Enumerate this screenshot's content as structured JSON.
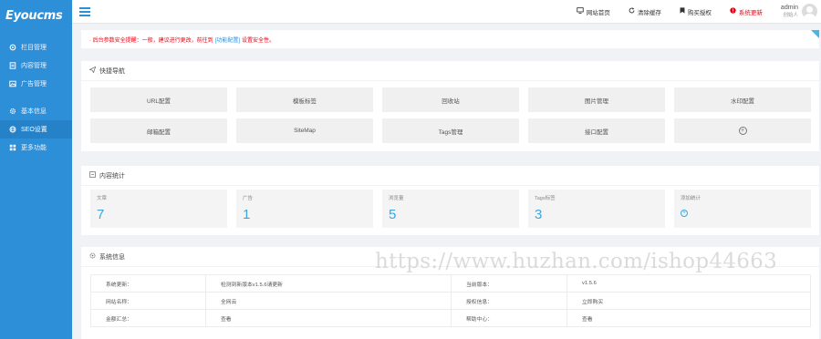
{
  "logo": {
    "text": "Eyoucms"
  },
  "sidebar": {
    "items": [
      {
        "label": "栏目管理",
        "icon": "settings-icon"
      },
      {
        "label": "内容管理",
        "icon": "document-icon"
      },
      {
        "label": "广告管理",
        "icon": "image-icon"
      },
      {
        "label": "基本信息",
        "icon": "gear-icon"
      },
      {
        "label": "SEO设置",
        "icon": "globe-icon"
      },
      {
        "label": "更多功能",
        "icon": "grid-icon"
      }
    ],
    "active_index": 4
  },
  "topbar": {
    "links": [
      {
        "label": "网站首页",
        "icon": "monitor-icon"
      },
      {
        "label": "清除缓存",
        "icon": "refresh-icon"
      },
      {
        "label": "购买授权",
        "icon": "bookmark-icon"
      },
      {
        "label": "系统更新",
        "icon": "alert-icon"
      }
    ],
    "user": {
      "name": "admin",
      "role": "创始人"
    }
  },
  "notice": {
    "prefix": "· 后台参数安全提醒：一般，建议进行更改，前往到",
    "link": "[功能配置]",
    "suffix": "设置安全性。"
  },
  "quick_nav": {
    "title": "快捷导航",
    "items": [
      "URL配置",
      "模板标签",
      "回收站",
      "图片管理",
      "水印配置",
      "邮箱配置",
      "SiteMap",
      "Tags管理",
      "接口配置",
      "+"
    ]
  },
  "stats": {
    "title": "内容统计",
    "items": [
      {
        "label": "文章",
        "value": "7"
      },
      {
        "label": "广告",
        "value": "1"
      },
      {
        "label": "浏览量",
        "value": "5"
      },
      {
        "label": "Tags标签",
        "value": "3"
      },
      {
        "label": "添加统计",
        "value": "+"
      }
    ]
  },
  "sysinfo": {
    "title": "系统信息",
    "rows": [
      {
        "l1": "系统更新：",
        "v1": "检测到新版本v1.5.6请更新",
        "l2": "当前版本：",
        "v2": "v1.5.6"
      },
      {
        "l1": "网站名称：",
        "v1": "全网云",
        "l2": "授权信息：",
        "v2": "立即购买"
      },
      {
        "l1": "金额汇总：",
        "v1": "查看",
        "l2": "帮助中心：",
        "v2": "查看"
      }
    ]
  },
  "watermark": {
    "text": "https://www.huzhan.com/ishop44663"
  },
  "colors": {
    "sidebar": "#2e8fd9",
    "accent": "#3ba6de",
    "alert": "#e60012"
  }
}
